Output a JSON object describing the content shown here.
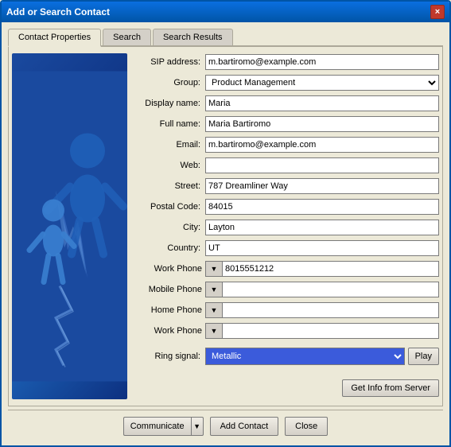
{
  "window": {
    "title": "Add or Search Contact",
    "close_icon": "×"
  },
  "tabs": [
    {
      "id": "contact-properties",
      "label": "Contact Properties",
      "active": true
    },
    {
      "id": "search",
      "label": "Search",
      "active": false
    },
    {
      "id": "search-results",
      "label": "Search Results",
      "active": false
    }
  ],
  "form": {
    "sip_label": "SIP address:",
    "sip_value": "m.bartiromo@example.com",
    "group_label": "Group:",
    "group_value": "Product Management",
    "display_name_label": "Display name:",
    "display_name_value": "Maria",
    "full_name_label": "Full name:",
    "full_name_value": "Maria Bartiromo",
    "email_label": "Email:",
    "email_value": "m.bartiromo@example.com",
    "web_label": "Web:",
    "web_value": "",
    "street_label": "Street:",
    "street_value": "787 Dreamliner Way",
    "postal_code_label": "Postal Code:",
    "postal_code_value": "84015",
    "city_label": "City:",
    "city_value": "Layton",
    "country_label": "Country:",
    "country_value": "UT",
    "work_phone_label": "Work Phone",
    "work_phone_value": "8015551212",
    "mobile_phone_label": "Mobile Phone",
    "mobile_phone_value": "",
    "home_phone_label": "Home Phone",
    "home_phone_value": "",
    "work_phone2_label": "Work Phone",
    "work_phone2_value": "",
    "ring_signal_label": "Ring signal:",
    "ring_signal_value": "Metallic",
    "play_label": "Play",
    "get_info_label": "Get Info from Server"
  },
  "bottom": {
    "communicate_label": "Communicate",
    "add_contact_label": "Add Contact",
    "close_label": "Close"
  }
}
